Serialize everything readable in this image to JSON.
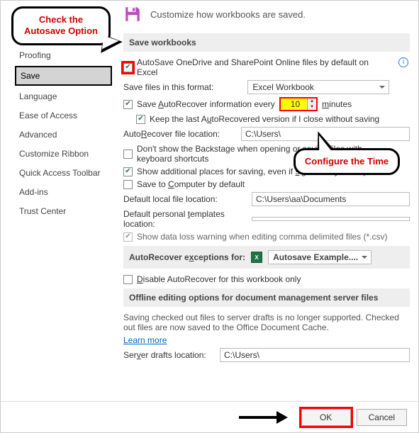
{
  "callouts": {
    "autosave": "Check the Autosave Option",
    "time": "Configure the Time"
  },
  "header": {
    "desc": "Customize how workbooks are saved."
  },
  "sidebar": {
    "items": [
      {
        "label": "Proofing"
      },
      {
        "label": "Save"
      },
      {
        "label": "Language"
      },
      {
        "label": "Ease of Access"
      },
      {
        "label": "Advanced"
      },
      {
        "label": "Customize Ribbon"
      },
      {
        "label": "Quick Access Toolbar"
      },
      {
        "label": "Add-ins"
      },
      {
        "label": "Trust Center"
      }
    ],
    "selected_index": 1
  },
  "sections": {
    "save_workbooks": "Save workbooks",
    "autorecover_exceptions": "AutoRecover exceptions for:",
    "offline": "Offline editing options for document management server files"
  },
  "save": {
    "autosave_label": "AutoSave OneDrive and SharePoint Online files by default on Excel",
    "format_label": "Save files in this format:",
    "format_value": "Excel Workbook",
    "autorecover_label_pre": "Save AutoRecover information every",
    "autorecover_value": "10",
    "autorecover_label_post": "minutes",
    "keep_last_label": "Keep the last AutoRecovered version if I close without saving",
    "ar_location_label": "AutoRecover file location:",
    "ar_location_value": "C:\\Users\\",
    "no_backstage_label": "Don't show the Backstage when opening or saving files with keyboard shortcuts",
    "additional_places_label": "Show additional places for saving, even if sign-in may be required.",
    "save_to_computer_label": "Save to Computer by default",
    "default_local_label": "Default local file location:",
    "default_local_value": "C:\\Users\\aa\\Documents",
    "default_templates_label": "Default personal templates location:",
    "default_templates_value": "",
    "csv_warning_label": "Show data loss warning when editing comma delimited files (*.csv)"
  },
  "exceptions": {
    "workbook": "Autosave Example....",
    "disable_label": "Disable AutoRecover for this workbook only"
  },
  "offline": {
    "note": "Saving checked out files to server drafts is no longer supported. Checked out files are now saved to the Office Document Cache.",
    "learn_more": "Learn more",
    "drafts_label": "Server drafts location:",
    "drafts_value": "C:\\Users\\"
  },
  "buttons": {
    "ok": "OK",
    "cancel": "Cancel"
  }
}
